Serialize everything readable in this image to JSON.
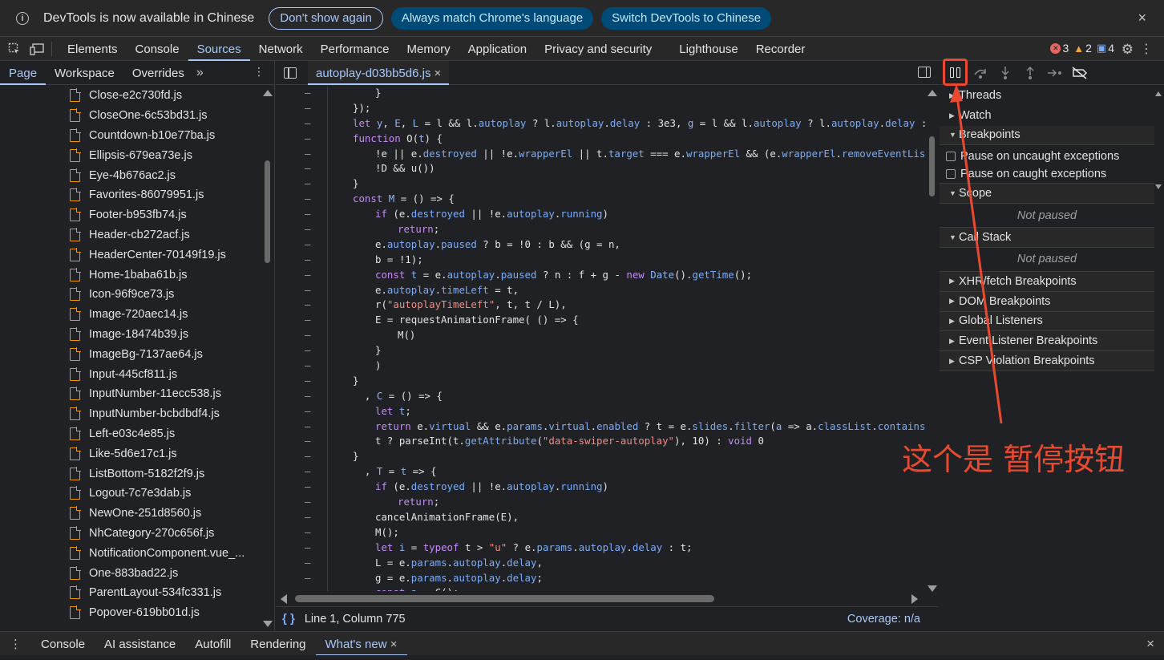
{
  "infobar": {
    "message": "DevTools is now available in Chinese",
    "btn_dont_show": "Don't show again",
    "btn_match": "Always match Chrome's language",
    "btn_switch": "Switch DevTools to Chinese",
    "close": "×"
  },
  "main_tabs": [
    "Elements",
    "Console",
    "Sources",
    "Network",
    "Performance",
    "Memory",
    "Application",
    "Privacy and security",
    "Lighthouse",
    "Recorder"
  ],
  "active_tab": "Sources",
  "badges": {
    "errors": "3",
    "warnings": "2",
    "messages": "4"
  },
  "left": {
    "subtabs": [
      "Page",
      "Workspace",
      "Overrides"
    ],
    "more": "»",
    "files": [
      "Close-e2c730fd.js",
      "CloseOne-6c53bd31.js",
      "Countdown-b10e77ba.js",
      "Ellipsis-679ea73e.js",
      "Eye-4b676ac2.js",
      "Favorites-86079951.js",
      "Footer-b953fb74.js",
      "Header-cb272acf.js",
      "HeaderCenter-70149f19.js",
      "Home-1baba61b.js",
      "Icon-96f9ce73.js",
      "Image-720aec14.js",
      "Image-18474b39.js",
      "ImageBg-7137ae64.js",
      "Input-445cf811.js",
      "InputNumber-11ecc538.js",
      "InputNumber-bcbdbdf4.js",
      "Left-e03c4e85.js",
      "Like-5d6e17c1.js",
      "ListBottom-5182f2f9.js",
      "Logout-7c7e3dab.js",
      "NewOne-251d8560.js",
      "NhCategory-270c656f.js",
      "NotificationComponent.vue_...",
      "One-883bad22.js",
      "ParentLayout-534fc331.js",
      "Popover-619bb01d.js"
    ]
  },
  "editor": {
    "file_tab": "autoplay-d03bb5d6.js",
    "tab_close": "×",
    "status_position": "Line 1, Column 775",
    "coverage": "Coverage: n/a",
    "braces": "{ }",
    "gutter_mark": "–"
  },
  "right": {
    "sections": {
      "threads": "Threads",
      "watch": "Watch",
      "breakpoints": "Breakpoints",
      "pause_uncaught": "Pause on uncaught exceptions",
      "pause_caught": "Pause on caught exceptions",
      "scope": "Scope",
      "not_paused_1": "Not paused",
      "call_stack": "Call Stack",
      "not_paused_2": "Not paused",
      "xhr": "XHR/fetch Breakpoints",
      "dom": "DOM Breakpoints",
      "global": "Global Listeners",
      "event": "Event Listener Breakpoints",
      "csp": "CSP Violation Breakpoints"
    }
  },
  "drawer": {
    "tabs": [
      "Console",
      "AI assistance",
      "Autofill",
      "Rendering",
      "What's new"
    ],
    "active": "What's new",
    "close": "×"
  },
  "annotation": {
    "text": "这个是 暂停按钮",
    "color": "#e8492f"
  }
}
